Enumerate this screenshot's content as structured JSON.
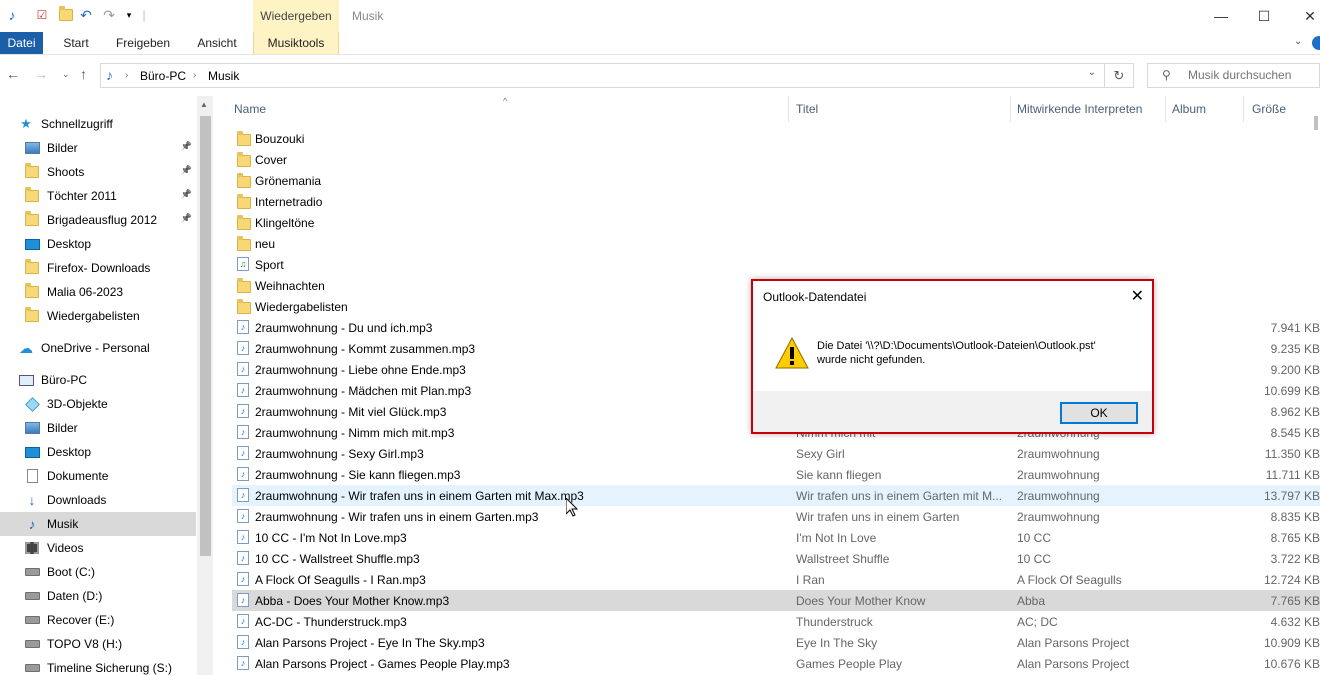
{
  "window": {
    "context_tab_header": "Wiedergeben",
    "title": "Musik"
  },
  "ribbon": {
    "tabs": [
      "Datei",
      "Start",
      "Freigeben",
      "Ansicht",
      "Musiktools"
    ]
  },
  "address": {
    "segments": [
      "Büro-PC",
      "Musik"
    ],
    "search_placeholder": "Musik durchsuchen"
  },
  "sidebar": {
    "items": [
      {
        "label": "Schnellzugriff",
        "icon": "star-icon"
      },
      {
        "label": "Bilder",
        "icon": "pictures-icon",
        "pinned": true
      },
      {
        "label": "Shoots",
        "icon": "folder-icon",
        "pinned": true
      },
      {
        "label": "Töchter 2011",
        "icon": "folder-icon",
        "pinned": true
      },
      {
        "label": "Brigadeausflug 2012",
        "icon": "folder-icon",
        "pinned": true
      },
      {
        "label": "Desktop",
        "icon": "desktop-icon"
      },
      {
        "label": "Firefox- Downloads",
        "icon": "folder-icon"
      },
      {
        "label": "Malia 06-2023",
        "icon": "folder-icon"
      },
      {
        "label": "Wiedergabelisten",
        "icon": "folder-icon"
      },
      {
        "label": "OneDrive - Personal",
        "icon": "cloud-icon"
      },
      {
        "label": "Büro-PC",
        "icon": "computer-icon"
      },
      {
        "label": "3D-Objekte",
        "icon": "cube-icon"
      },
      {
        "label": "Bilder",
        "icon": "pictures-icon"
      },
      {
        "label": "Desktop",
        "icon": "desktop-icon"
      },
      {
        "label": "Dokumente",
        "icon": "document-icon"
      },
      {
        "label": "Downloads",
        "icon": "download-icon"
      },
      {
        "label": "Musik",
        "icon": "music-icon",
        "selected": true
      },
      {
        "label": "Videos",
        "icon": "video-icon"
      },
      {
        "label": "Boot (C:)",
        "icon": "drive-icon"
      },
      {
        "label": "Daten (D:)",
        "icon": "drive-icon"
      },
      {
        "label": "Recover (E:)",
        "icon": "drive-icon"
      },
      {
        "label": "TOPO V8 (H:)",
        "icon": "drive-icon"
      },
      {
        "label": "Timeline Sicherung (S:)",
        "icon": "drive-icon"
      }
    ]
  },
  "columns": [
    "Name",
    "Titel",
    "Mitwirkende Interpreten",
    "Album",
    "Größe"
  ],
  "rows": [
    {
      "name": "Bouzouki",
      "type": "folder",
      "title": "",
      "artist": "",
      "size": ""
    },
    {
      "name": "Cover",
      "type": "folder",
      "title": "",
      "artist": "",
      "size": ""
    },
    {
      "name": "Grönemania",
      "type": "folder",
      "title": "",
      "artist": "",
      "size": ""
    },
    {
      "name": "Internetradio",
      "type": "folder",
      "title": "",
      "artist": "",
      "size": ""
    },
    {
      "name": "Klingeltöne",
      "type": "folder",
      "title": "",
      "artist": "",
      "size": ""
    },
    {
      "name": "neu",
      "type": "folder",
      "title": "",
      "artist": "",
      "size": ""
    },
    {
      "name": "Sport",
      "type": "playlist",
      "title": "",
      "artist": "",
      "size": ""
    },
    {
      "name": "Weihnachten",
      "type": "folder",
      "title": "",
      "artist": "",
      "size": ""
    },
    {
      "name": "Wiedergabelisten",
      "type": "folder",
      "title": "",
      "artist": "",
      "size": ""
    },
    {
      "name": "2raumwohnung - Du und ich.mp3",
      "type": "audio",
      "title": "",
      "artist": "",
      "size": "7.941 KB"
    },
    {
      "name": "2raumwohnung - Kommt zusammen.mp3",
      "type": "audio",
      "title": "",
      "artist": "",
      "size": "9.235 KB"
    },
    {
      "name": "2raumwohnung - Liebe ohne Ende.mp3",
      "type": "audio",
      "title": "",
      "artist": "",
      "size": "9.200 KB"
    },
    {
      "name": "2raumwohnung - Mädchen mit Plan.mp3",
      "type": "audio",
      "title": "",
      "artist": "",
      "size": "10.699 KB"
    },
    {
      "name": "2raumwohnung - Mit viel Glück.mp3",
      "type": "audio",
      "title": "",
      "artist": "",
      "size": "8.962 KB"
    },
    {
      "name": "2raumwohnung - Nimm mich mit.mp3",
      "type": "audio",
      "title": "Nimm mich mit",
      "artist": "2raumwohnung",
      "size": "8.545 KB"
    },
    {
      "name": "2raumwohnung - Sexy Girl.mp3",
      "type": "audio",
      "title": "Sexy Girl",
      "artist": "2raumwohnung",
      "size": "11.350 KB"
    },
    {
      "name": "2raumwohnung - Sie kann fliegen.mp3",
      "type": "audio",
      "title": "Sie kann fliegen",
      "artist": "2raumwohnung",
      "size": "11.711 KB"
    },
    {
      "name": "2raumwohnung - Wir trafen uns in einem Garten mit Max.mp3",
      "type": "audio",
      "title": "Wir trafen uns in einem Garten mit M...",
      "artist": "2raumwohnung",
      "size": "13.797 KB",
      "state": "hover"
    },
    {
      "name": "2raumwohnung - Wir trafen uns in einem Garten.mp3",
      "type": "audio",
      "title": "Wir trafen uns in einem Garten",
      "artist": "2raumwohnung",
      "size": "8.835 KB"
    },
    {
      "name": "10 CC - I'm Not In Love.mp3",
      "type": "audio",
      "title": "I'm Not In Love",
      "artist": "10 CC",
      "size": "8.765 KB"
    },
    {
      "name": "10 CC - Wallstreet Shuffle.mp3",
      "type": "audio",
      "title": "Wallstreet Shuffle",
      "artist": "10 CC",
      "size": "3.722 KB"
    },
    {
      "name": "A Flock Of Seagulls - I Ran.mp3",
      "type": "audio",
      "title": "I Ran",
      "artist": "A Flock Of Seagulls",
      "size": "12.724 KB"
    },
    {
      "name": "Abba - Does Your Mother Know.mp3",
      "type": "audio",
      "title": "Does Your Mother Know",
      "artist": "Abba",
      "size": "7.765 KB",
      "state": "selected"
    },
    {
      "name": "AC-DC - Thunderstruck.mp3",
      "type": "audio",
      "title": "Thunderstruck",
      "artist": "AC; DC",
      "size": "4.632 KB"
    },
    {
      "name": "Alan Parsons Project - Eye In The Sky.mp3",
      "type": "audio",
      "title": "Eye In The Sky",
      "artist": "Alan Parsons Project",
      "size": "10.909 KB"
    },
    {
      "name": "Alan Parsons Project - Games People Play.mp3",
      "type": "audio",
      "title": "Games People Play",
      "artist": "Alan Parsons Project",
      "size": "10.676 KB"
    }
  ],
  "dialog": {
    "title": "Outlook-Datendatei",
    "message_line1": "Die Datei '\\\\?\\D:\\Documents\\Outlook-Dateien\\Outlook.pst'",
    "message_line2": "wurde nicht gefunden.",
    "ok_label": "OK"
  }
}
